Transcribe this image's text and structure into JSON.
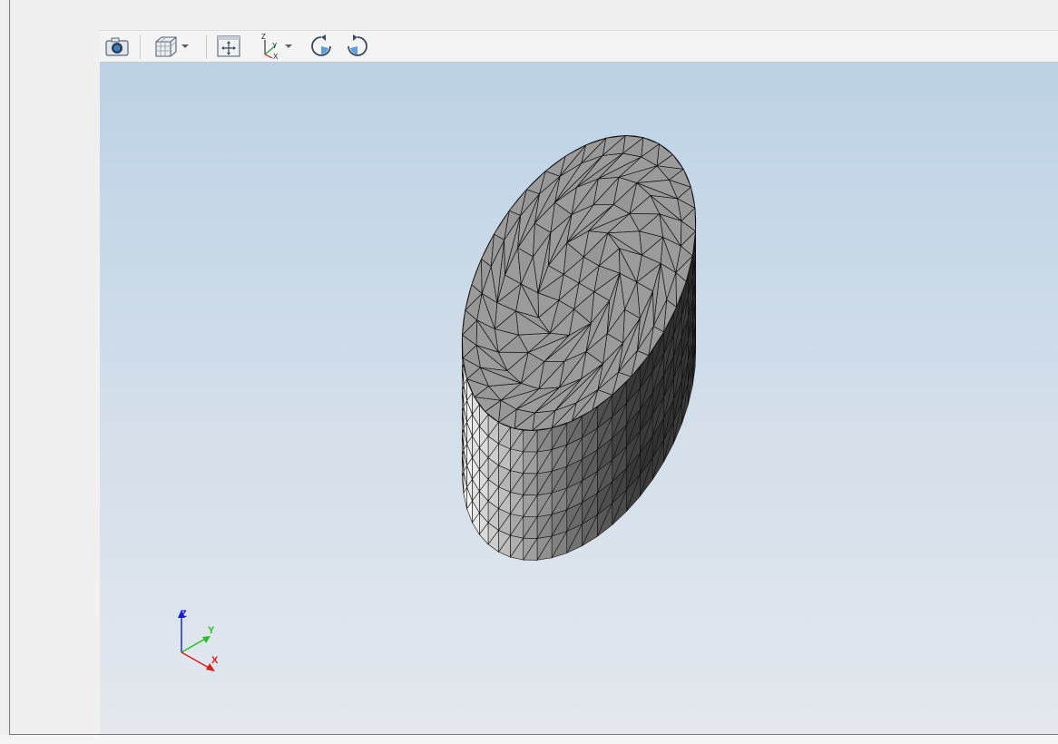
{
  "toolbar": {
    "buttons": [
      {
        "name": "screenshot-button",
        "icon": "camera-icon"
      },
      {
        "name": "view-style-button",
        "icon": "cube-icon",
        "dropdown": true
      },
      {
        "name": "fit-view-button",
        "icon": "fit-view-icon"
      },
      {
        "name": "view-orientation-button",
        "icon": "axes-icon",
        "dropdown": true
      },
      {
        "name": "rotate-ccw-button",
        "icon": "rotate-left-icon"
      },
      {
        "name": "rotate-cw-button",
        "icon": "rotate-right-icon"
      }
    ],
    "axes_icon_labels": {
      "z": "Z",
      "y": "Y",
      "x": "X"
    }
  },
  "viewport": {
    "gradient_top": "#bdd2e6",
    "gradient_bottom": "#e4e8ee",
    "model": "meshed-elliptic-cylinder"
  },
  "triad": {
    "z_label": "Z",
    "y_label": "Y",
    "x_label": "X",
    "z_color": "#1a1ad8",
    "y_color": "#22c022",
    "x_color": "#e01818"
  }
}
